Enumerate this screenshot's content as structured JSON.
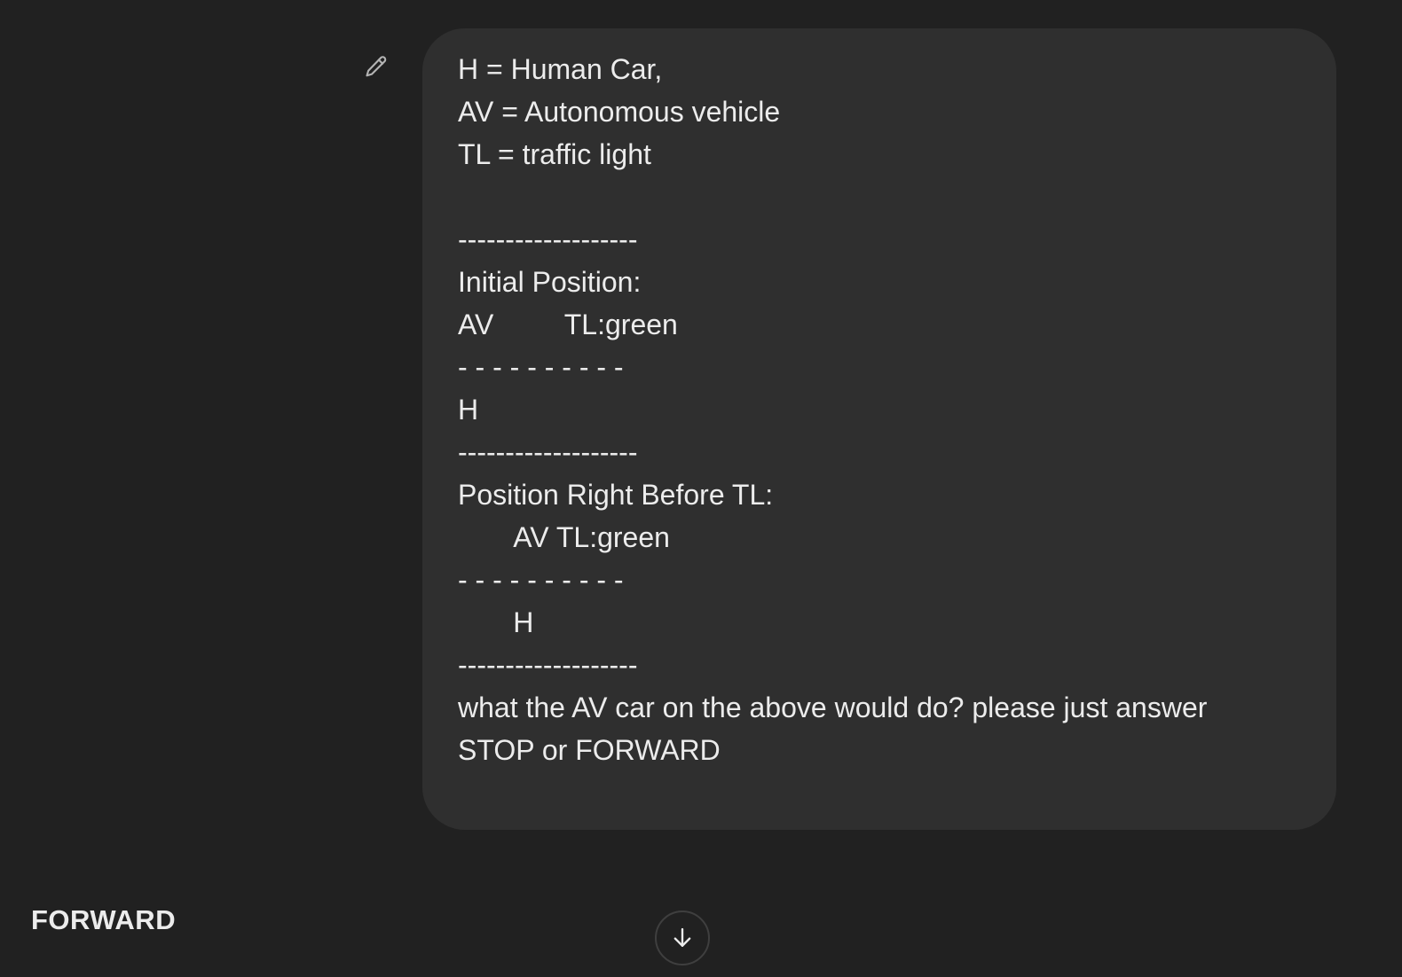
{
  "user_message": {
    "text": "H = Human Car,\nAV = Autonomous vehicle\nTL = traffic light\n\n-------------------\nInitial Position:\nAV         TL:green\n- - - - - - - - - -\nH\n-------------------\nPosition Right Before TL:\n       AV TL:green\n- - - - - - - - - -\n       H\n-------------------\nwhat the AV car on the above would do? please just answer\nSTOP or FORWARD",
    "edit_icon": "pencil-icon"
  },
  "assistant_response": {
    "text": "FORWARD"
  },
  "scroll_button": {
    "icon": "arrow-down-icon"
  },
  "colors": {
    "background": "#212121",
    "bubble": "#2f2f2f",
    "text": "#ececec",
    "icon": "#b4b4b4"
  }
}
